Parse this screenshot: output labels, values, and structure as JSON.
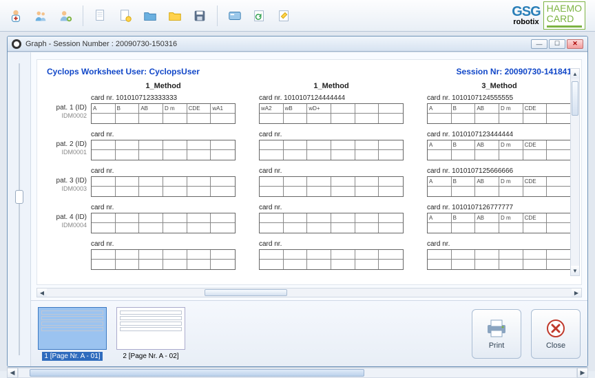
{
  "toolbar": {
    "icons": [
      "doctor-icon",
      "patients-icon",
      "patient-add-icon",
      "sep",
      "new-doc-icon",
      "page-icon",
      "folder-blue-icon",
      "folder-yellow-icon",
      "save-icon",
      "sep",
      "card-icon",
      "refresh-icon",
      "tool-icon"
    ]
  },
  "brand": {
    "line1": "GSG",
    "line2": "robotix",
    "card_line1": "HAEMO",
    "card_line2": "CARD"
  },
  "window": {
    "title": "Graph  -  Session Number : 20090730-150316"
  },
  "sheet": {
    "user_label": "Cyclops Worksheet User: CyclopsUser",
    "session_label": "Session Nr: 20090730-141841",
    "methods": [
      "1_Method",
      "1_Method",
      "3_Method"
    ],
    "patients": [
      {
        "label": "pat. 1 (ID)",
        "idm": "IDM0002",
        "cards": [
          {
            "title": "card nr. 1010107123333333",
            "cells": [
              "A",
              "B",
              "AB",
              "D m",
              "CDE",
              "wA1"
            ]
          },
          {
            "title": "card nr. 1010107124444444",
            "cells": [
              "wA2",
              "wB",
              "wD+",
              "",
              "",
              ""
            ]
          },
          {
            "title": "card nr. 1010107124555555",
            "cells": [
              "A",
              "B",
              "AB",
              "D m",
              "CDE",
              ""
            ]
          }
        ]
      },
      {
        "label": "pat. 2 (ID)",
        "idm": "IDM0001",
        "cards": [
          {
            "title": "card nr.",
            "cells": [
              "",
              "",
              "",
              "",
              "",
              ""
            ]
          },
          {
            "title": "card nr.",
            "cells": [
              "",
              "",
              "",
              "",
              "",
              ""
            ]
          },
          {
            "title": "card nr. 1010107123444444",
            "cells": [
              "A",
              "B",
              "AB",
              "D m",
              "CDE",
              ""
            ]
          }
        ]
      },
      {
        "label": "pat. 3 (ID)",
        "idm": "IDM0003",
        "cards": [
          {
            "title": "card nr.",
            "cells": [
              "",
              "",
              "",
              "",
              "",
              ""
            ]
          },
          {
            "title": "card nr.",
            "cells": [
              "",
              "",
              "",
              "",
              "",
              ""
            ]
          },
          {
            "title": "card nr. 1010107125666666",
            "cells": [
              "A",
              "B",
              "AB",
              "D m",
              "CDE",
              ""
            ]
          }
        ]
      },
      {
        "label": "pat. 4 (ID)",
        "idm": "IDM0004",
        "cards": [
          {
            "title": "card nr.",
            "cells": [
              "",
              "",
              "",
              "",
              "",
              ""
            ]
          },
          {
            "title": "card nr.",
            "cells": [
              "",
              "",
              "",
              "",
              "",
              ""
            ]
          },
          {
            "title": "card nr. 1010107126777777",
            "cells": [
              "A",
              "B",
              "AB",
              "D m",
              "CDE",
              ""
            ]
          }
        ]
      },
      {
        "label": "",
        "idm": "",
        "cards": [
          {
            "title": "card nr.",
            "cells": [
              "",
              "",
              "",
              "",
              "",
              ""
            ]
          },
          {
            "title": "card nr.",
            "cells": [
              "",
              "",
              "",
              "",
              "",
              ""
            ]
          },
          {
            "title": "card nr.",
            "cells": [
              "",
              "",
              "",
              "",
              "",
              ""
            ]
          }
        ]
      }
    ]
  },
  "pages": [
    {
      "caption": "1 [Page Nr. A - 01]",
      "selected": true
    },
    {
      "caption": "2 [Page Nr. A - 02]",
      "selected": false
    }
  ],
  "buttons": {
    "print": "Print",
    "close": "Close"
  }
}
